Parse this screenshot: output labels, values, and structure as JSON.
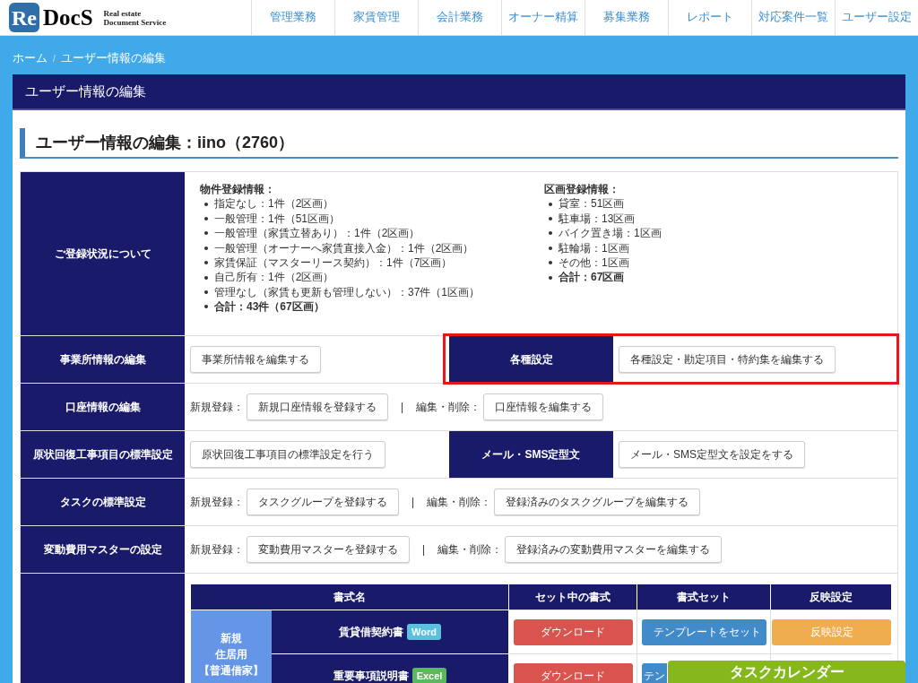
{
  "logo": {
    "mark": "Re",
    "name": "DocS",
    "tagline": [
      "Real estate",
      "Document Service"
    ]
  },
  "nav": [
    "管理業務",
    "家賃管理",
    "会計業務",
    "オーナー精算",
    "募集業務",
    "レポート",
    "対応案件一覧",
    "ユーザー設定"
  ],
  "breadcrumb": [
    "ホーム",
    "ユーザー情報の編集"
  ],
  "breadcrumb_separator": "/",
  "panel_title": "ユーザー情報の編集",
  "heading": "ユーザー情報の編集：iino（2760）",
  "rows": [
    {
      "kind": "status",
      "label": "ご登録状況について",
      "columns": [
        {
          "title": "物件登録情報：",
          "items": [
            "指定なし：1件（2区画）",
            "一般管理：1件（51区画）",
            "一般管理（家賃立替あり）：1件（2区画）",
            "一般管理（オーナーへ家賃直接入金）：1件（2区画）",
            "家賃保証（マスターリース契約）：1件（7区画）",
            "自己所有：1件（2区画）",
            "管理なし（家賃も更新も管理しない）：37件（1区画）"
          ],
          "total": "合計：43件（67区画）"
        },
        {
          "title": "区画登録情報：",
          "items": [
            "貸室：51区画",
            "駐車場：13区画",
            "バイク置き場：1区画",
            "駐輪場：1区画",
            "その他：1区画"
          ],
          "total": "合計：67区画"
        }
      ]
    },
    {
      "kind": "split",
      "halves": [
        {
          "label": "事業所情報の編集",
          "button": "事業所情報を編集する",
          "highlighted": false
        },
        {
          "label": "各種設定",
          "button": "各種設定・勘定項目・特約集を編集する",
          "highlighted": true
        }
      ]
    },
    {
      "kind": "actions",
      "label": "口座情報の編集",
      "separator": "|",
      "groups": [
        {
          "caption": "新規登録：",
          "button": "新規口座情報を登録する"
        },
        {
          "caption": "編集・削除：",
          "button": "口座情報を編集する"
        }
      ]
    },
    {
      "kind": "split",
      "halves": [
        {
          "label": "原状回復工事項目の標準設定",
          "button": "原状回復工事項目の標準設定を行う",
          "highlighted": false
        },
        {
          "label": "メール・SMS定型文",
          "button": "メール・SMS定型文を設定をする",
          "highlighted": false
        }
      ]
    },
    {
      "kind": "actions",
      "label": "タスクの標準設定",
      "separator": "|",
      "groups": [
        {
          "caption": "新規登録：",
          "button": "タスクグループを登録する"
        },
        {
          "caption": "編集・削除：",
          "button": "登録済みのタスクグループを編集する"
        }
      ]
    },
    {
      "kind": "actions",
      "label": "変動費用マスターの設定",
      "separator": "|",
      "groups": [
        {
          "caption": "新規登録：",
          "button": "変動費用マスターを登録する"
        },
        {
          "caption": "編集・削除：",
          "button": "登録済みの変動費用マスターを編集する"
        }
      ]
    },
    {
      "kind": "forms",
      "columns": [
        "書式名",
        "セット中の書式",
        "書式セット",
        "反映設定"
      ],
      "group": [
        "新規",
        "住居用",
        "【普通借家】"
      ],
      "items": [
        {
          "name": "賃貸借契約書",
          "tag": {
            "text": "Word",
            "color": "#5bc0de"
          },
          "download": "ダウンロード",
          "template": "テンプレートをセット",
          "apply": "反映設定"
        },
        {
          "name": "重要事項説明書",
          "tag": {
            "text": "Excel",
            "color": "#5cb85c"
          },
          "download": "ダウンロード",
          "template": "テン"
        }
      ]
    }
  ],
  "floating_button": "タスクカレンダー"
}
